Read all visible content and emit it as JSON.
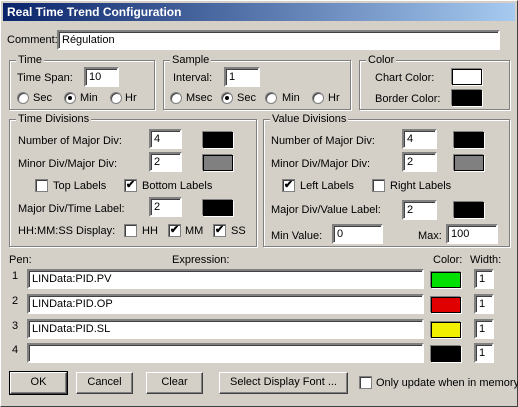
{
  "window": {
    "title": "Real Time Trend Configuration"
  },
  "comment": {
    "label": "Comment:",
    "value": "Régulation"
  },
  "time": {
    "title": "Time",
    "span_label": "Time Span:",
    "span_value": "10",
    "units": [
      {
        "label": "Sec",
        "selected": false
      },
      {
        "label": "Min",
        "selected": true
      },
      {
        "label": "Hr",
        "selected": false
      }
    ]
  },
  "sample": {
    "title": "Sample",
    "interval_label": "Interval:",
    "interval_value": "1",
    "units": [
      {
        "label": "Msec",
        "selected": false
      },
      {
        "label": "Sec",
        "selected": true
      },
      {
        "label": "Min",
        "selected": false
      },
      {
        "label": "Hr",
        "selected": false
      }
    ]
  },
  "color": {
    "title": "Color",
    "chart_label": "Chart Color:",
    "chart_color": "#ffffff",
    "border_label": "Border Color:",
    "border_color": "#000000"
  },
  "time_divisions": {
    "title": "Time Divisions",
    "major_label": "Number of Major Div:",
    "major_value": "4",
    "major_color": "#000000",
    "minor_label": "Minor Div/Major Div:",
    "minor_value": "2",
    "minor_color": "#808080",
    "top_labels": {
      "label": "Top Labels",
      "checked": false
    },
    "bottom_labels": {
      "label": "Bottom Labels",
      "checked": true
    },
    "per_label_label": "Major Div/Time Label:",
    "per_label_value": "2",
    "per_label_color": "#000000",
    "display_label": "HH:MM:SS Display:",
    "hh": {
      "label": "HH",
      "checked": false
    },
    "mm": {
      "label": "MM",
      "checked": true
    },
    "ss": {
      "label": "SS",
      "checked": true
    }
  },
  "value_divisions": {
    "title": "Value Divisions",
    "major_label": "Number of Major Div:",
    "major_value": "4",
    "major_color": "#000000",
    "minor_label": "Minor Div/Major Div:",
    "minor_value": "2",
    "minor_color": "#808080",
    "left_labels": {
      "label": "Left Labels",
      "checked": true
    },
    "right_labels": {
      "label": "Right Labels",
      "checked": false
    },
    "per_label_label": "Major Div/Value Label:",
    "per_label_value": "2",
    "per_label_color": "#000000",
    "min_label": "Min Value:",
    "min_value": "0",
    "max_label": "Max:",
    "max_value": "100"
  },
  "pens": {
    "pen_header": "Pen:",
    "expression_header": "Expression:",
    "color_header": "Color:",
    "width_header": "Width:",
    "rows": [
      {
        "num": "1",
        "expression": "LINData:PID.PV",
        "color": "#00e000",
        "width": "1"
      },
      {
        "num": "2",
        "expression": "LINData:PID.OP",
        "color": "#e00000",
        "width": "1"
      },
      {
        "num": "3",
        "expression": "LINData:PID.SL",
        "color": "#f0f000",
        "width": "1"
      },
      {
        "num": "4",
        "expression": "",
        "color": "#000000",
        "width": "1"
      }
    ]
  },
  "buttons": {
    "ok": "OK",
    "cancel": "Cancel",
    "clear": "Clear",
    "font": "Select Display Font ..."
  },
  "memory_only": {
    "label": "Only update when in memory",
    "checked": false
  }
}
